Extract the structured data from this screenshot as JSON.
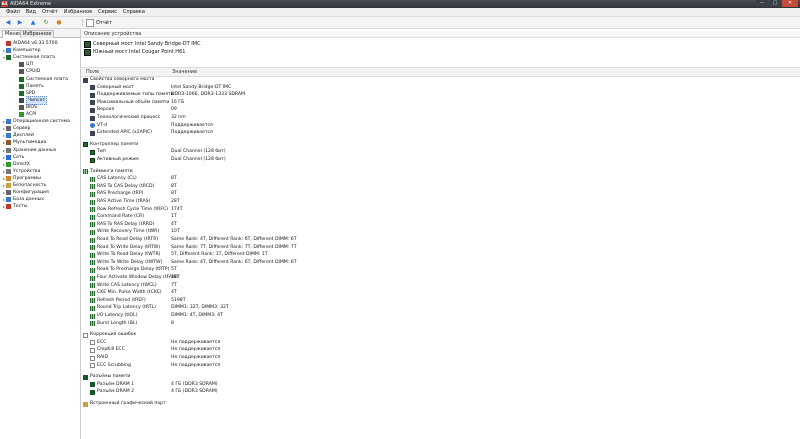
{
  "window": {
    "app_icon_text": "64",
    "title": "AIDA64 Extreme",
    "min_glyph": "—",
    "max_glyph": "□",
    "close_glyph": "✕"
  },
  "menu": [
    "Файл",
    "Вид",
    "Отчёт",
    "Избранное",
    "Сервис",
    "Справка"
  ],
  "toolbar": {
    "back_glyph": "◀",
    "forward_glyph": "▶",
    "up_glyph": "▲",
    "refresh_glyph": "↻",
    "user_glyph": "●",
    "report_label": "Отчёт",
    "colors": {
      "back": "#2a6fdb",
      "forward": "#2a6fdb",
      "up": "#2a6fdb",
      "refresh": "#2f9a2f",
      "user": "#d4882a"
    }
  },
  "left_panel": {
    "tabs": [
      "Меню",
      "Избранное"
    ],
    "tree": [
      {
        "label": "AIDA64 v6.33.5700",
        "icon": "aida-icon",
        "color": "#c0392b",
        "expander": "",
        "selected": false
      },
      {
        "label": "Компьютер",
        "icon": "computer-icon",
        "color": "#3a78c8",
        "expander": "▸",
        "selected": false
      },
      {
        "label": "Системная плата",
        "icon": "motherboard-icon",
        "color": "#1d6b2a",
        "expander": "▾",
        "selected": false
      },
      {
        "label": "ЦП",
        "icon": "cpu-icon",
        "color": "#555555",
        "expander": "",
        "selected": false
      },
      {
        "label": "CPUID",
        "icon": "cpuid-icon",
        "color": "#555555",
        "expander": "",
        "selected": false
      },
      {
        "label": "Системная плата",
        "icon": "board-icon",
        "color": "#1d6b2a",
        "expander": "",
        "selected": false
      },
      {
        "label": "Память",
        "icon": "memory-icon",
        "color": "#1d6b2a",
        "expander": "",
        "selected": false
      },
      {
        "label": "SPD",
        "icon": "spd-icon",
        "color": "#1d6b2a",
        "expander": "",
        "selected": false
      },
      {
        "label": "Чипсет",
        "icon": "chipset-icon",
        "color": "#3c4450",
        "expander": "",
        "selected": true
      },
      {
        "label": "BIOS",
        "icon": "bios-icon",
        "color": "#555555",
        "expander": "",
        "selected": false
      },
      {
        "label": "ACPI",
        "icon": "acpi-icon",
        "color": "#2f9a2f",
        "expander": "",
        "selected": false
      },
      {
        "label": "Операционная система",
        "icon": "os-icon",
        "color": "#3a78c8",
        "expander": "▸",
        "selected": false
      },
      {
        "label": "Сервер",
        "icon": "server-icon",
        "color": "#666666",
        "expander": "▸",
        "selected": false
      },
      {
        "label": "Дисплей",
        "icon": "display-icon",
        "color": "#3a78c8",
        "expander": "▸",
        "selected": false
      },
      {
        "label": "Мультимедиа",
        "icon": "multimedia-icon",
        "color": "#8a5a2a",
        "expander": "▸",
        "selected": false
      },
      {
        "label": "Хранение данных",
        "icon": "storage-icon",
        "color": "#777777",
        "expander": "▸",
        "selected": false
      },
      {
        "label": "Сеть",
        "icon": "network-icon",
        "color": "#2a6fdb",
        "expander": "▸",
        "selected": false
      },
      {
        "label": "DirectX",
        "icon": "directx-icon",
        "color": "#2f9a2f",
        "expander": "▸",
        "selected": false
      },
      {
        "label": "Устройства",
        "icon": "devices-icon",
        "color": "#777777",
        "expander": "▸",
        "selected": false
      },
      {
        "label": "Программы",
        "icon": "programs-icon",
        "color": "#d4882a",
        "expander": "▸",
        "selected": false
      },
      {
        "label": "Безопасность",
        "icon": "security-icon",
        "color": "#c9a13a",
        "expander": "▸",
        "selected": false
      },
      {
        "label": "Конфигурация",
        "icon": "config-icon",
        "color": "#666666",
        "expander": "▸",
        "selected": false
      },
      {
        "label": "База данных",
        "icon": "database-icon",
        "color": "#3a78c8",
        "expander": "▸",
        "selected": false
      },
      {
        "label": "Тесты",
        "icon": "tests-icon",
        "color": "#c0392b",
        "expander": "▸",
        "selected": false
      }
    ]
  },
  "description": {
    "header": "Описание устройства",
    "items": [
      "Северный мост Intel Sandy Bridge-DT IMC",
      "Южный мост Intel Cougar Point H61"
    ]
  },
  "columns": {
    "field": "Поле",
    "value": "Значение"
  },
  "rows": [
    {
      "kind": "header",
      "field": "Свойства северного моста",
      "value": "",
      "icon": "sq"
    },
    {
      "kind": "item",
      "field": "Северный мост",
      "value": "Intel Sandy Bridge-DT IMC",
      "icon": "sq"
    },
    {
      "kind": "item",
      "field": "Поддерживаемые типы памяти",
      "value": "DDR3-1066, DDR3-1333 SDRAM",
      "icon": "sq"
    },
    {
      "kind": "item",
      "field": "Максимальный объём памяти",
      "value": "16 ГБ",
      "icon": "sq"
    },
    {
      "kind": "item",
      "field": "Версия",
      "value": "09",
      "icon": "sq"
    },
    {
      "kind": "item",
      "field": "Технологический процесс",
      "value": "32 nm",
      "icon": "sq"
    },
    {
      "kind": "item",
      "field": "VT-d",
      "value": "Поддерживается",
      "icon": "info"
    },
    {
      "kind": "item",
      "field": "Extended APIC (x2APIC)",
      "value": "Поддерживается",
      "icon": "sq"
    },
    {
      "kind": "gap"
    },
    {
      "kind": "header",
      "field": "Контроллер памяти",
      "value": "",
      "icon": "grn"
    },
    {
      "kind": "item",
      "field": "Тип",
      "value": "Dual Channel  (128 бит)",
      "icon": "grn"
    },
    {
      "kind": "item",
      "field": "Активный режим",
      "value": "Dual Channel  (128 бит)",
      "icon": "grn"
    },
    {
      "kind": "gap"
    },
    {
      "kind": "header",
      "field": "Тайминги памяти",
      "value": "",
      "icon": "bars"
    },
    {
      "kind": "item",
      "field": "CAS Latency (CL)",
      "value": "8T",
      "icon": "bars"
    },
    {
      "kind": "item",
      "field": "RAS To CAS Delay (tRCD)",
      "value": "8T",
      "icon": "bars"
    },
    {
      "kind": "item",
      "field": "RAS Precharge (tRP)",
      "value": "8T",
      "icon": "bars"
    },
    {
      "kind": "item",
      "field": "RAS Active Time (tRAS)",
      "value": "28T",
      "icon": "bars"
    },
    {
      "kind": "item",
      "field": "Row Refresh Cycle Time (tRFC)",
      "value": "174T",
      "icon": "bars"
    },
    {
      "kind": "item",
      "field": "Command Rate (CR)",
      "value": "1T",
      "icon": "bars"
    },
    {
      "kind": "item",
      "field": "RAS To RAS Delay (tRRD)",
      "value": "4T",
      "icon": "bars"
    },
    {
      "kind": "item",
      "field": "Write Recovery Time (tWR)",
      "value": "10T",
      "icon": "bars"
    },
    {
      "kind": "item",
      "field": "Read To Read Delay (tRTR)",
      "value": "Same Rank: 4T, Different Rank: 6T, Different DIMM: 6T",
      "icon": "bars"
    },
    {
      "kind": "item",
      "field": "Read To Write Delay (tRTW)",
      "value": "Same Rank: 7T, Different Rank: 7T, Different DIMM: 7T",
      "icon": "bars"
    },
    {
      "kind": "item",
      "field": "Write To Read Delay (tWTR)",
      "value": "5T, Different Rank: 1T, Different DIMM: 1T",
      "icon": "bars"
    },
    {
      "kind": "item",
      "field": "Write To Write Delay (tWTW)",
      "value": "Same Rank: 4T, Different Rank: 6T, Different DIMM: 6T",
      "icon": "bars"
    },
    {
      "kind": "item",
      "field": "Read To Precharge Delay (tRTP)",
      "value": "5T",
      "icon": "bars"
    },
    {
      "kind": "item",
      "field": "Four Activate Window Delay (tFAW)",
      "value": "18T",
      "icon": "bars"
    },
    {
      "kind": "item",
      "field": "Write CAS Latency (tWCL)",
      "value": "7T",
      "icon": "bars"
    },
    {
      "kind": "item",
      "field": "CKE Min. Pulse Width (tCKE)",
      "value": "4T",
      "icon": "bars"
    },
    {
      "kind": "item",
      "field": "Refresh Period (tREF)",
      "value": "5198T",
      "icon": "bars"
    },
    {
      "kind": "item",
      "field": "Round Trip Latency (tRTL)",
      "value": "DIMM1: 32T, DIMM3: 32T",
      "icon": "bars"
    },
    {
      "kind": "item",
      "field": "I/O Latency (tIOL)",
      "value": "DIMM1: 4T, DIMM3: 4T",
      "icon": "bars"
    },
    {
      "kind": "item",
      "field": "Burst Length (BL)",
      "value": "8",
      "icon": "bars"
    },
    {
      "kind": "gap"
    },
    {
      "kind": "header",
      "field": "Коррекция ошибок",
      "value": "",
      "icon": "cb"
    },
    {
      "kind": "item",
      "field": "ECC",
      "value": "Не поддерживается",
      "icon": "cb"
    },
    {
      "kind": "item",
      "field": "ChipKill ECC",
      "value": "Не поддерживается",
      "icon": "cb"
    },
    {
      "kind": "item",
      "field": "RAID",
      "value": "Не поддерживается",
      "icon": "cb"
    },
    {
      "kind": "item",
      "field": "ECC Scrubbing",
      "value": "Не поддерживается",
      "icon": "cb"
    },
    {
      "kind": "gap"
    },
    {
      "kind": "header",
      "field": "Разъёмы памяти",
      "value": "",
      "icon": "chip"
    },
    {
      "kind": "item",
      "field": "Разъём DRAM 1",
      "value": "4 ГБ  (DDR3 SDRAM)",
      "icon": "chip"
    },
    {
      "kind": "item",
      "field": "Разъём DRAM 2",
      "value": "4 ГБ  (DDR3 SDRAM)",
      "icon": "chip"
    },
    {
      "kind": "gap"
    },
    {
      "kind": "header",
      "field": "Встроенный графический порт",
      "value": "",
      "icon": "card"
    }
  ]
}
